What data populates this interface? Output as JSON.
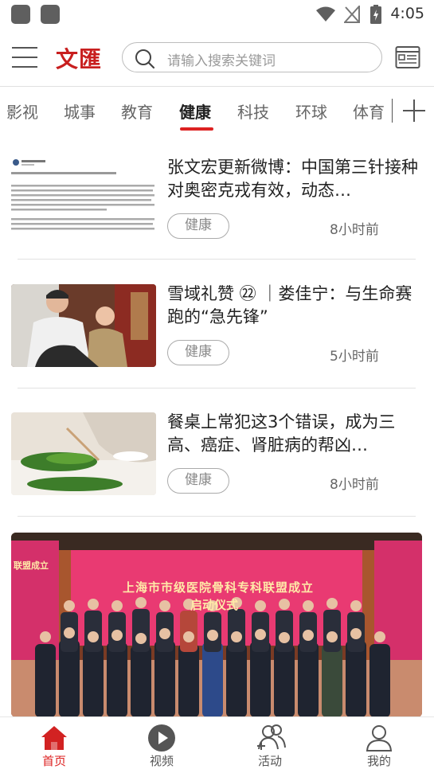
{
  "status_bar": {
    "time": "4:05"
  },
  "header": {
    "logo_text": "文匯",
    "search_placeholder": "请输入搜索关键词"
  },
  "tabs": [
    {
      "label": "影视"
    },
    {
      "label": "城事"
    },
    {
      "label": "教育"
    },
    {
      "label": "健康",
      "active": true
    },
    {
      "label": "科技"
    },
    {
      "label": "环球"
    },
    {
      "label": "体育"
    }
  ],
  "articles": [
    {
      "title": "张文宏更新微博：中国第三针接种对奥密克戎有效，动态…",
      "tag": "健康",
      "time": "8小时前"
    },
    {
      "title": "雪域礼赞 ㉒ ｜娄佳宁：与生命赛跑的“急先锋”",
      "tag": "健康",
      "time": "5小时前"
    },
    {
      "title": "餐桌上常犯这3个错误，成为三高、癌症、肾脏病的帮凶…",
      "tag": "健康",
      "time": "8小时前"
    }
  ],
  "feature_photo": {
    "banner_text": "上海市市级医院骨科专科联盟成立",
    "banner_text2": "启动仪式",
    "side_text": "联盟成立"
  },
  "bottom_nav": [
    {
      "label": "首页",
      "icon": "home-icon",
      "active": true
    },
    {
      "label": "视频",
      "icon": "video-play-icon"
    },
    {
      "label": "活动",
      "icon": "activity-people-icon"
    },
    {
      "label": "我的",
      "icon": "profile-icon"
    }
  ],
  "colors": {
    "accent": "#d22222",
    "logo": "#c81f1f"
  }
}
